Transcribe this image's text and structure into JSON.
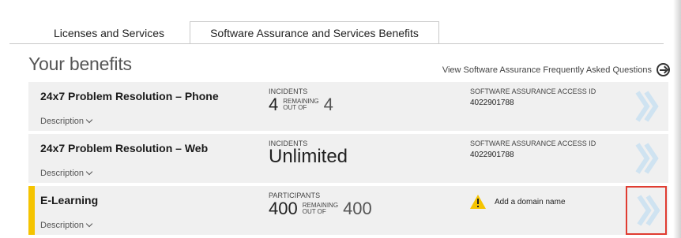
{
  "tabs": [
    {
      "label": "Licenses and Services",
      "active": false
    },
    {
      "label": "Software Assurance and Services Benefits",
      "active": true
    }
  ],
  "heading": "Your benefits",
  "faq_link": "View Software Assurance Frequently Asked Questions",
  "common": {
    "description_label": "Description",
    "remaining_label": "REMAINING",
    "out_of_label": "OUT OF",
    "access_id_label": "SOFTWARE ASSURANCE ACCESS ID"
  },
  "benefits": [
    {
      "name": "24x7 Problem Resolution – Phone",
      "metric_label": "INCIDENTS",
      "remaining": "4",
      "total": "4",
      "access_id": "4022901788"
    },
    {
      "name": "24x7 Problem Resolution – Web",
      "metric_label": "INCIDENTS",
      "value": "Unlimited",
      "access_id": "4022901788"
    },
    {
      "name": "E-Learning",
      "metric_label": "PARTICIPANTS",
      "remaining": "400",
      "total": "400",
      "warning": "Add a domain name"
    }
  ],
  "colors": {
    "accent_bar": "#f5c400",
    "row_bg": "#f0f0f0",
    "chevron": "#cfe3f1",
    "highlight_border": "#e03c31",
    "warning": "#f5c400"
  },
  "icons": [
    "arrow-circle-right-icon",
    "chevron-down-icon",
    "warning-icon",
    "double-chevron-right-icon"
  ]
}
